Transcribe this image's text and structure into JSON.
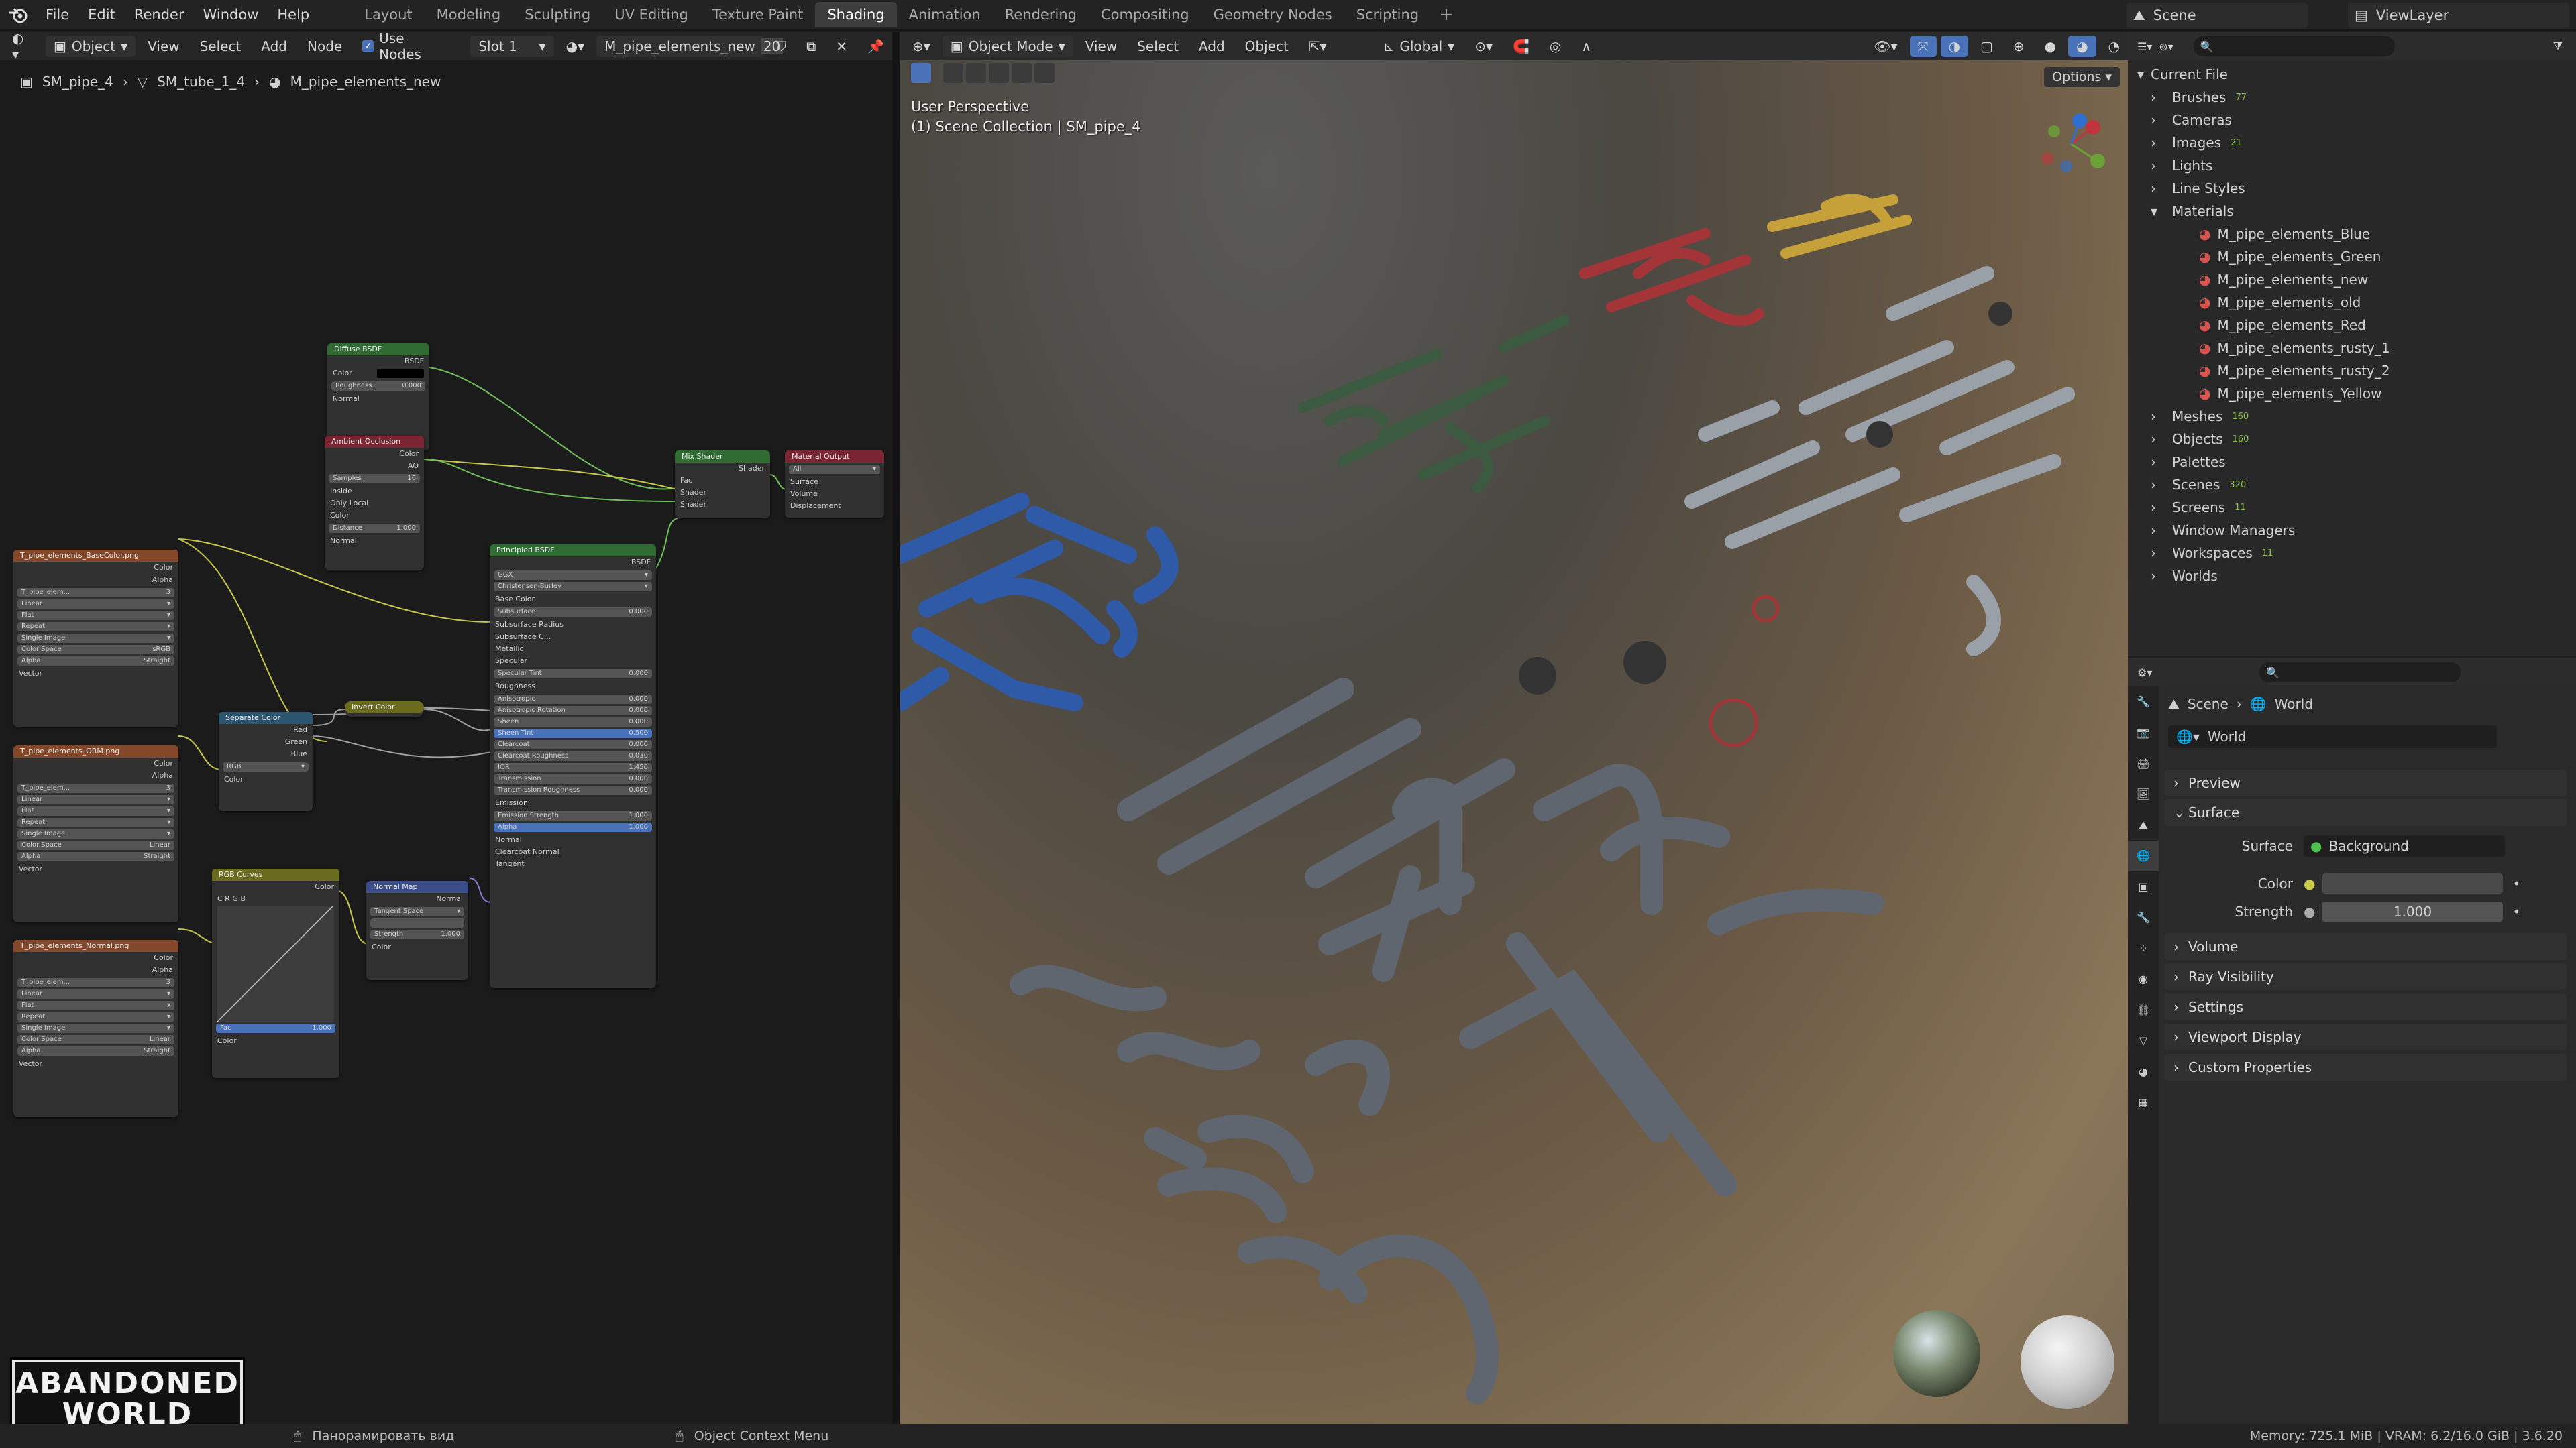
{
  "top_menu": [
    "File",
    "Edit",
    "Render",
    "Window",
    "Help"
  ],
  "workspaces": [
    "Layout",
    "Modeling",
    "Sculpting",
    "UV Editing",
    "Texture Paint",
    "Shading",
    "Animation",
    "Rendering",
    "Compositing",
    "Geometry Nodes",
    "Scripting"
  ],
  "active_workspace": "Shading",
  "scene_name": "Scene",
  "view_layer": "ViewLayer",
  "node_editor": {
    "object_mode": "Object",
    "menus": [
      "View",
      "Select",
      "Add",
      "Node"
    ],
    "use_nodes_label": "Use Nodes",
    "slot": "Slot 1",
    "material_name": "M_pipe_elements_new",
    "user_count": "20",
    "breadcrumb": [
      "SM_pipe_4",
      "SM_tube_1_4",
      "M_pipe_elements_new"
    ]
  },
  "nodes": {
    "diffuse": {
      "title": "Diffuse BSDF",
      "out": "BSDF",
      "color": "Color",
      "roughness": "Roughness",
      "roughness_val": "0.000",
      "normal": "Normal"
    },
    "ao": {
      "title": "Ambient Occlusion",
      "color": "Color",
      "ao": "AO",
      "samples": "Samples",
      "samples_val": "16",
      "inside": "Inside",
      "only_local": "Only Local",
      "color_in": "Color",
      "distance": "Distance",
      "distance_val": "1.000",
      "normal": "Normal"
    },
    "mix": {
      "title": "Mix Shader",
      "out": "Shader",
      "fac": "Fac",
      "s1": "Shader",
      "s2": "Shader"
    },
    "output": {
      "title": "Material Output",
      "target": "All",
      "surface": "Surface",
      "volume": "Volume",
      "displacement": "Displacement"
    },
    "principled": {
      "title": "Principled BSDF",
      "out": "BSDF",
      "dist": "GGX",
      "sss": "Christensen-Burley",
      "rows": [
        [
          "Base Color",
          ""
        ],
        [
          "Subsurface",
          "0.000"
        ],
        [
          "Subsurface Radius",
          ""
        ],
        [
          "Subsurface C...",
          ""
        ],
        [
          "Metallic",
          ""
        ],
        [
          "Specular",
          ""
        ],
        [
          "Specular Tint",
          "0.000"
        ],
        [
          "Roughness",
          ""
        ],
        [
          "Anisotropic",
          "0.000"
        ],
        [
          "Anisotropic Rotation",
          "0.000"
        ],
        [
          "Sheen",
          "0.000"
        ],
        [
          "Sheen Tint",
          "0.500"
        ],
        [
          "Clearcoat",
          "0.000"
        ],
        [
          "Clearcoat Roughness",
          "0.030"
        ],
        [
          "IOR",
          "1.450"
        ],
        [
          "Transmission",
          "0.000"
        ],
        [
          "Transmission Roughness",
          "0.000"
        ],
        [
          "Emission",
          ""
        ],
        [
          "Emission Strength",
          "1.000"
        ],
        [
          "Alpha",
          "1.000"
        ],
        [
          "Normal",
          ""
        ],
        [
          "Clearcoat Normal",
          ""
        ],
        [
          "Tangent",
          ""
        ]
      ]
    },
    "img1": {
      "title": "T_pipe_elements_BaseColor.png",
      "color": "Color",
      "alpha": "Alpha",
      "file": "T_pipe_elem...",
      "users": "3",
      "interp": "Linear",
      "proj": "Flat",
      "ext": "Repeat",
      "src": "Single Image",
      "cs_label": "Color Space",
      "cs": "sRGB",
      "alpha_label": "Alpha",
      "alpha_mode": "Straight",
      "vector": "Vector"
    },
    "img2": {
      "title": "T_pipe_elements_ORM.png",
      "color": "Color",
      "alpha": "Alpha",
      "file": "T_pipe_elem...",
      "users": "3",
      "interp": "Linear",
      "proj": "Flat",
      "ext": "Repeat",
      "src": "Single Image",
      "cs_label": "Color Space",
      "cs": "Linear",
      "alpha_label": "Alpha",
      "alpha_mode": "Straight",
      "vector": "Vector"
    },
    "img3": {
      "title": "T_pipe_elements_Normal.png",
      "color": "Color",
      "alpha": "Alpha",
      "file": "T_pipe_elem...",
      "users": "3",
      "interp": "Linear",
      "proj": "Flat",
      "ext": "Repeat",
      "src": "Single Image",
      "cs_label": "Color Space",
      "cs": "Linear",
      "alpha_label": "Alpha",
      "alpha_mode": "Straight",
      "vector": "Vector"
    },
    "sep": {
      "title": "Separate Color",
      "red": "Red",
      "green": "Green",
      "blue": "Blue",
      "mode": "RGB",
      "color": "Color"
    },
    "invert": {
      "title": "Invert Color"
    },
    "curves": {
      "title": "RGB Curves",
      "color": "Color",
      "chans": "C  R  G  B",
      "fac": "Fac",
      "fac_val": "1.000",
      "color_in": "Color"
    },
    "normalmap": {
      "title": "Normal Map",
      "normal": "Normal",
      "space": "Tangent Space",
      "strength": "Strength",
      "strength_val": "1.000",
      "color": "Color"
    }
  },
  "viewport": {
    "mode": "Object Mode",
    "menus": [
      "View",
      "Select",
      "Add",
      "Object"
    ],
    "orientation": "Global",
    "options": "Options",
    "perspective": "User Perspective",
    "collection": "(1) Scene Collection | SM_pipe_4"
  },
  "outliner": {
    "root": "Current File",
    "items": [
      {
        "label": "Brushes",
        "count": "77"
      },
      {
        "label": "Cameras",
        "count": ""
      },
      {
        "label": "Images",
        "count": "21"
      },
      {
        "label": "Lights",
        "count": ""
      },
      {
        "label": "Line Styles",
        "count": ""
      },
      {
        "label": "Materials",
        "count": ""
      }
    ],
    "materials": [
      "M_pipe_elements_Blue",
      "M_pipe_elements_Green",
      "M_pipe_elements_new",
      "M_pipe_elements_old",
      "M_pipe_elements_Red",
      "M_pipe_elements_rusty_1",
      "M_pipe_elements_rusty_2",
      "M_pipe_elements_Yellow"
    ],
    "items2": [
      {
        "label": "Meshes",
        "count": "160"
      },
      {
        "label": "Objects",
        "count": "160"
      },
      {
        "label": "Palettes",
        "count": ""
      },
      {
        "label": "Scenes",
        "count": "320"
      },
      {
        "label": "Screens",
        "count": "11"
      },
      {
        "label": "Window Managers",
        "count": ""
      },
      {
        "label": "Workspaces",
        "count": "11"
      },
      {
        "label": "Worlds",
        "count": ""
      }
    ]
  },
  "properties": {
    "crumb_scene": "Scene",
    "crumb_world": "World",
    "world_name": "World",
    "panels": [
      "Preview",
      "Surface",
      "Volume",
      "Ray Visibility",
      "Settings",
      "Viewport Display",
      "Custom Properties"
    ],
    "surface_label": "Surface",
    "surface_value": "Background",
    "color_label": "Color",
    "strength_label": "Strength",
    "strength_value": "1.000"
  },
  "status": {
    "pan_view": "Панорамировать вид",
    "context_menu": "Object Context Menu",
    "memory": "Memory: 725.1 MiB | VRAM: 6.2/16.0 GiB | 3.6.20"
  },
  "watermark": {
    "line1": "ABANDONED",
    "line2": "WORLD"
  },
  "colors": {
    "accent": "#4a72b8",
    "active_tab": "#3d3d3d",
    "shader_green": "#2f6b33",
    "texture_orange": "#83482a",
    "input_red": "#7b2434",
    "vector_blue": "#3a4d8a",
    "converter_blue": "#2c5570",
    "color_yellow": "#6b6b1f"
  }
}
